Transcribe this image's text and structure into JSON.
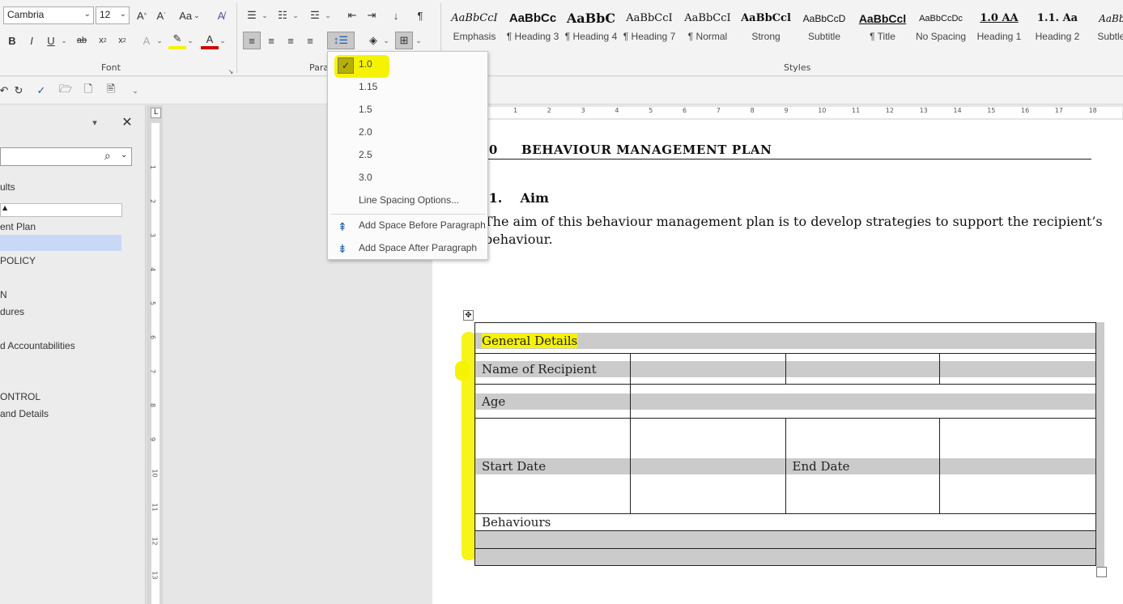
{
  "ribbon": {
    "font_name": "Cambria",
    "font_size": "12",
    "case_label": "Aa",
    "group_font": "Font",
    "group_paragraph": "Para",
    "group_styles": "Styles",
    "styles": [
      {
        "preview": "AaBbCcI",
        "name": "Emphasis"
      },
      {
        "preview": "AaBbCc",
        "name": "¶ Heading 3"
      },
      {
        "preview": "AaBbC",
        "name": "¶ Heading 4"
      },
      {
        "preview": "AaBbCcI",
        "name": "¶ Heading 7"
      },
      {
        "preview": "AaBbCcI",
        "name": "¶ Normal"
      },
      {
        "preview": "AaBbCcl",
        "name": "Strong"
      },
      {
        "preview": "AaBbCcD",
        "name": "Subtitle"
      },
      {
        "preview": "AaBbCcl",
        "name": "¶ Title"
      },
      {
        "preview": "AaBbCcDc",
        "name": "No Spacing"
      },
      {
        "preview": "1.0 AA",
        "name": "Heading 1"
      },
      {
        "preview": "1.1. Aa",
        "name": "Heading 2"
      },
      {
        "preview": "AaBbC",
        "name": "Subtle E"
      }
    ]
  },
  "line_spacing_menu": {
    "options": [
      "1.0",
      "1.15",
      "1.5",
      "2.0",
      "2.5",
      "3.0"
    ],
    "selected": "1.0",
    "more": "Line Spacing Options...",
    "add_before": "Add Space Before Paragraph",
    "add_after": "Add Space After Paragraph"
  },
  "nav_pane": {
    "items": [
      "ults",
      "ent Plan",
      "POLICY",
      "N",
      "dures",
      "d Accountabilities",
      "ONTROL",
      "and Details"
    ]
  },
  "ruler": {
    "h_numbers": [
      "1",
      "2",
      "3",
      "4",
      "5",
      "6",
      "7",
      "8",
      "9",
      "10",
      "11",
      "12",
      "13",
      "14",
      "15",
      "16",
      "17",
      "18"
    ],
    "v_numbers": [
      "1",
      "2",
      "3",
      "4",
      "5",
      "6",
      "7",
      "8",
      "9",
      "10",
      "11",
      "12",
      "13"
    ]
  },
  "document": {
    "heading1": ".0     BEHAVIOUR MANAGEMENT PLAN",
    "heading2": ".1.    Aim",
    "paragraph_line1": "The aim of this behaviour management plan is to develop strategies to support the recipient’s",
    "paragraph_line2": "behaviour.",
    "table": {
      "general_details": "General Details",
      "name_of_recipient": "Name of Recipient",
      "age": "Age",
      "start_date": "Start Date",
      "end_date": "End Date",
      "behaviours": "Behaviours"
    }
  }
}
